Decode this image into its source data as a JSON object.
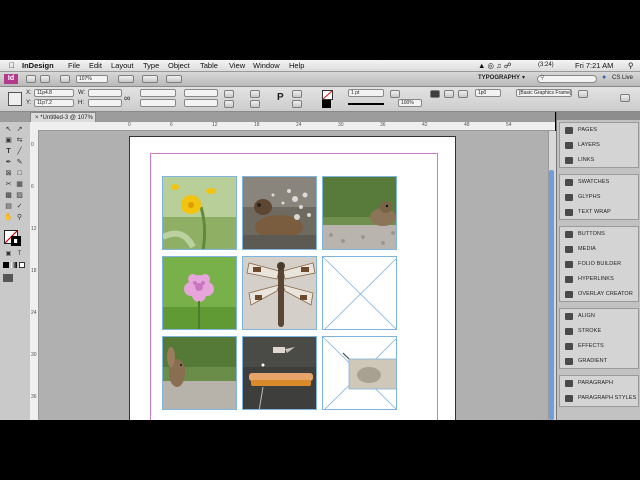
{
  "menubar": {
    "app_name": "InDesign",
    "menus": [
      "File",
      "Edit",
      "Layout",
      "Type",
      "Object",
      "Table",
      "View",
      "Window",
      "Help"
    ],
    "status": {
      "battery": "(3:24)",
      "clock": "Fri 7:21 AM"
    }
  },
  "appbar": {
    "zoom": "107%",
    "workspace": "TYPOGRAPHY",
    "search_placeholder": "",
    "cs_live": "CS Live"
  },
  "controlbar": {
    "x_value": "11p4.8",
    "y_value": "11p7.2",
    "w_label": "W:",
    "h_label": "H:",
    "stroke_weight": "1 pt",
    "scale_value": "100%",
    "spacing_value": "1p0",
    "frame_style": "[Basic Graphics Frame]"
  },
  "document": {
    "tab_label": "*Untitled-3 @ 107%"
  },
  "rulers": {
    "h_marks": [
      "6",
      "12",
      "18",
      "24",
      "30",
      "36",
      "42",
      "48",
      "54",
      "60"
    ],
    "v_marks": [
      "6",
      "12",
      "18",
      "24",
      "30",
      "36"
    ]
  },
  "grid": {
    "cells": [
      {
        "type": "photo",
        "subject": "yellow flower"
      },
      {
        "type": "photo",
        "subject": "duck splashing"
      },
      {
        "type": "photo",
        "subject": "bird on gravel"
      },
      {
        "type": "photo",
        "subject": "pink clover"
      },
      {
        "type": "photo",
        "subject": "dragonfly"
      },
      {
        "type": "empty",
        "subject": "empty placeholder frame"
      },
      {
        "type": "photo",
        "subject": "squirrel"
      },
      {
        "type": "photo",
        "subject": "hummingbird feeder"
      },
      {
        "type": "partial",
        "subject": "placeholder frame with small photo"
      }
    ]
  },
  "panels": {
    "groups": [
      [
        "PAGES",
        "LAYERS",
        "LINKS"
      ],
      [
        "SWATCHES",
        "GLYPHS",
        "TEXT WRAP"
      ],
      [
        "BUTTONS",
        "MEDIA",
        "FOLIO BUILDER",
        "HYPERLINKS",
        "OVERLAY CREATOR"
      ],
      [
        "ALIGN",
        "STROKE",
        "EFFECTS",
        "GRADIENT"
      ],
      [
        "PARAGRAPH",
        "PARAGRAPH STYLES"
      ]
    ]
  },
  "colors": {
    "frame_border": "#7fb3e0",
    "margin_guide": "#c77cc7",
    "pasteboard": "#b0b0b0",
    "scroll_accent": "#6f9fd8"
  }
}
